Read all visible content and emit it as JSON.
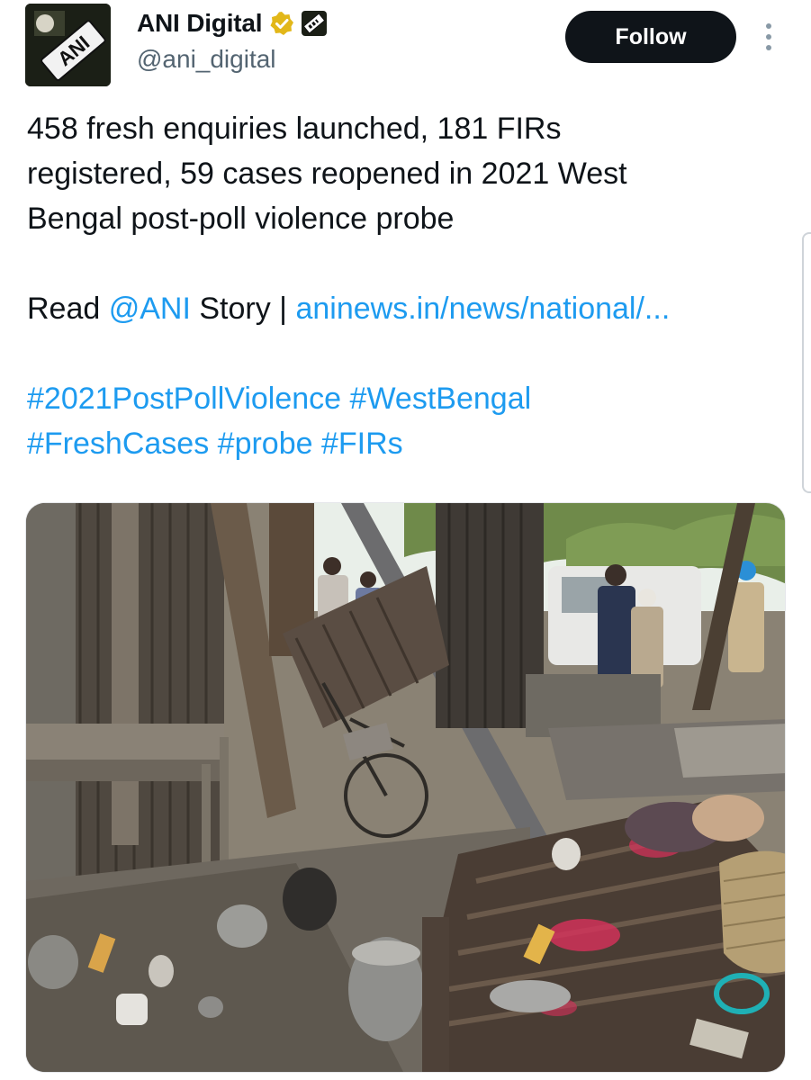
{
  "author": {
    "display_name": "ANI Digital",
    "handle": "@ani_digital",
    "avatar_text": "ANI",
    "verified_icon": "verified-badge-icon",
    "affiliate_icon": "ani-affiliate-badge-icon"
  },
  "actions": {
    "follow_label": "Follow",
    "more_icon": "more-vertical-icon"
  },
  "tweet": {
    "line1": "458 fresh enquiries launched, 181 FIRs",
    "line2": "registered, 59 cases reopened in 2021 West",
    "line3": "Bengal post-poll violence probe",
    "read_prefix": "Read ",
    "mention": "@ANI",
    "story_text": " Story | ",
    "url": "aninews.in/news/national/...",
    "hashtags_line1": [
      "#2021PostPollViolence",
      "#WestBengal"
    ],
    "hashtags_line2": [
      "#FreshCases",
      "#probe",
      "#FIRs"
    ]
  },
  "media": {
    "description_icon": "photo-image",
    "colors": {
      "wood": "#5b4a3a",
      "tin": "#6e6a62",
      "sky": "#e9efe9",
      "tree": "#6f8a4a",
      "pink": "#d8315b"
    }
  },
  "colors": {
    "link": "#1d9bf0",
    "text": "#0f1419",
    "muted": "#536471",
    "button": "#0f1419"
  }
}
